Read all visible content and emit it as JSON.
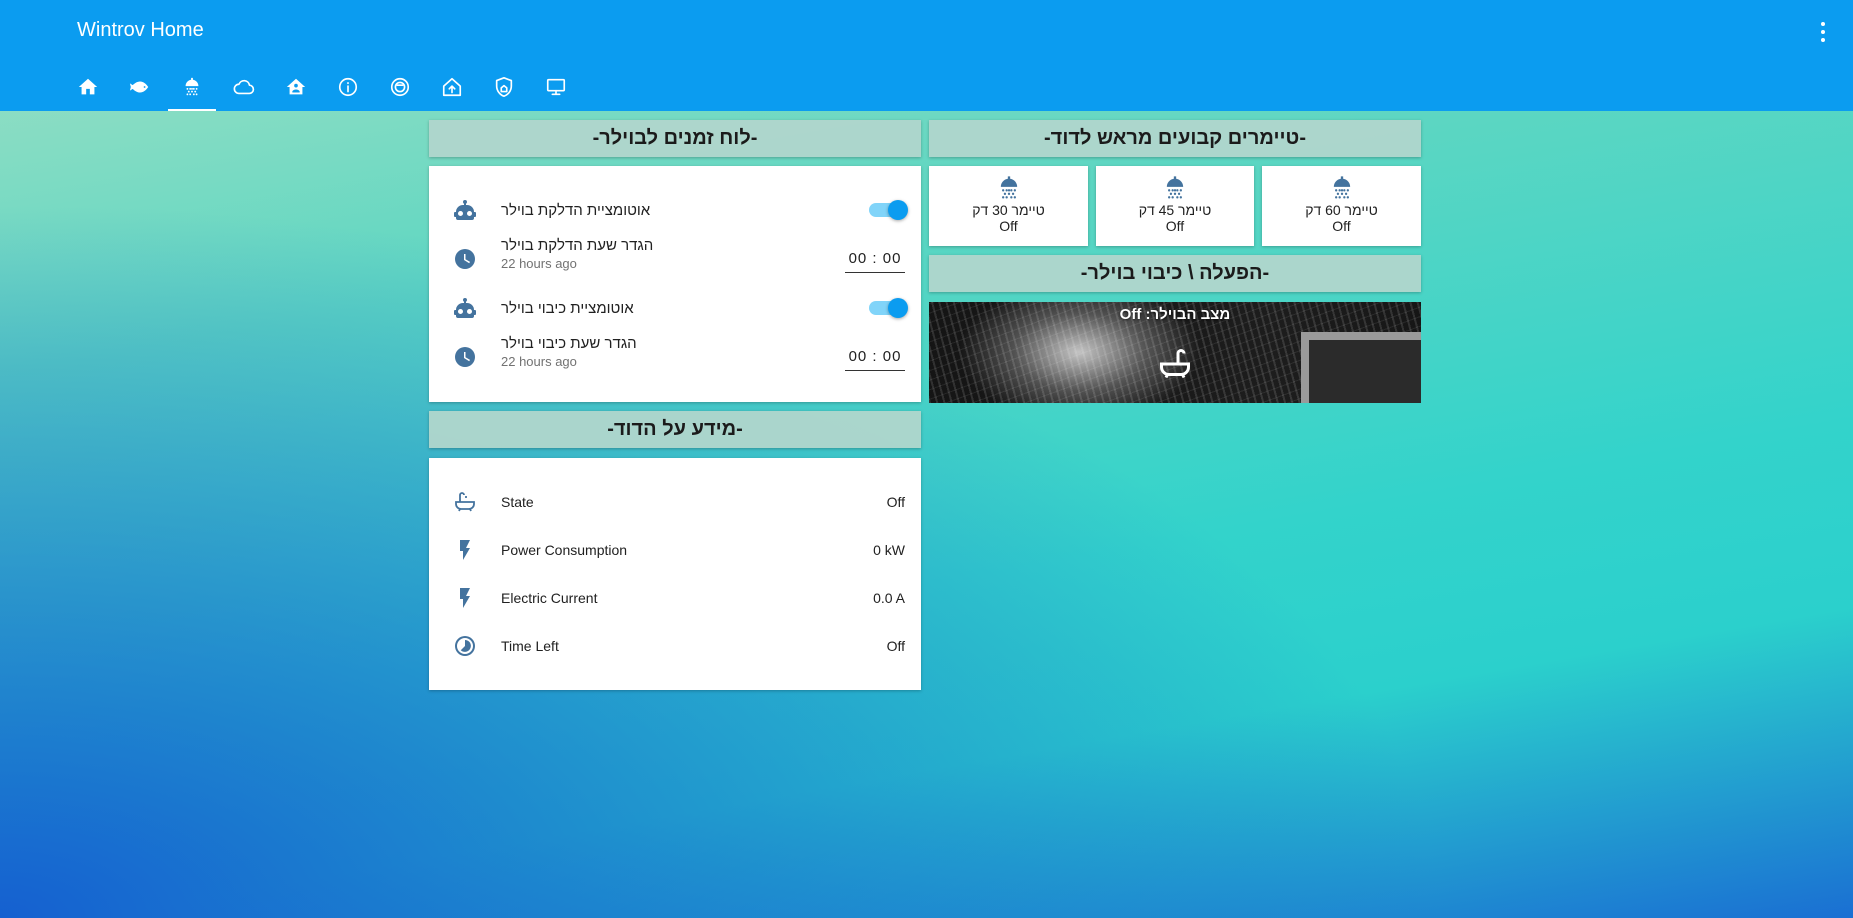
{
  "header": {
    "title": "Wintrov Home",
    "tabs": [
      {
        "icon": "home-icon"
      },
      {
        "icon": "fish-icon"
      },
      {
        "icon": "shower-icon",
        "active": true
      },
      {
        "icon": "cloud-icon"
      },
      {
        "icon": "home-account-icon"
      },
      {
        "icon": "information-icon"
      },
      {
        "icon": "robot-vacuum-icon"
      },
      {
        "icon": "home-import-icon"
      },
      {
        "icon": "shield-home-icon"
      },
      {
        "icon": "monitor-icon"
      }
    ]
  },
  "schedule": {
    "title": "-לוח זמנים לבוילר-",
    "rows": [
      {
        "label": "אוטומציית הדלקת בוילר",
        "icon": "robot-icon",
        "toggle": true
      },
      {
        "label": "הגדר שעת הדלקת בוילר",
        "sub": "22 hours ago",
        "icon": "clock-icon",
        "time": "00 : 00"
      },
      {
        "label": "אוטומציית כיבוי בוילר",
        "icon": "robot-icon",
        "toggle": true
      },
      {
        "label": "הגדר שעת כיבוי בוילר",
        "sub": "22 hours ago",
        "icon": "clock-icon",
        "time": "00 : 00"
      }
    ]
  },
  "info": {
    "title": "-מידע על הדוד-",
    "rows": [
      {
        "label": "State",
        "value": "Off",
        "icon": "bathtub-icon"
      },
      {
        "label": "Power Consumption",
        "value": "0 kW",
        "icon": "flash-icon"
      },
      {
        "label": "Electric Current",
        "value": "0.0 A",
        "icon": "flash-icon"
      },
      {
        "label": "Time Left",
        "value": "Off",
        "icon": "timelapse-icon"
      }
    ]
  },
  "timers": {
    "title": "-טיימרים קבועים מראש לדוד-",
    "items": [
      {
        "label": "טיימר 30 דק",
        "state": "Off"
      },
      {
        "label": "טיימר 45 דק",
        "state": "Off"
      },
      {
        "label": "טיימר 60 דק",
        "state": "Off"
      }
    ]
  },
  "toggle_section": {
    "title": "-הפעלה \\ כיבוי בוילר-",
    "picture_title": "מצב הבוילר: Off"
  },
  "colors": {
    "header": "#0b9cf0",
    "icon": "#44739e",
    "section_header": "#b0d6cc"
  }
}
